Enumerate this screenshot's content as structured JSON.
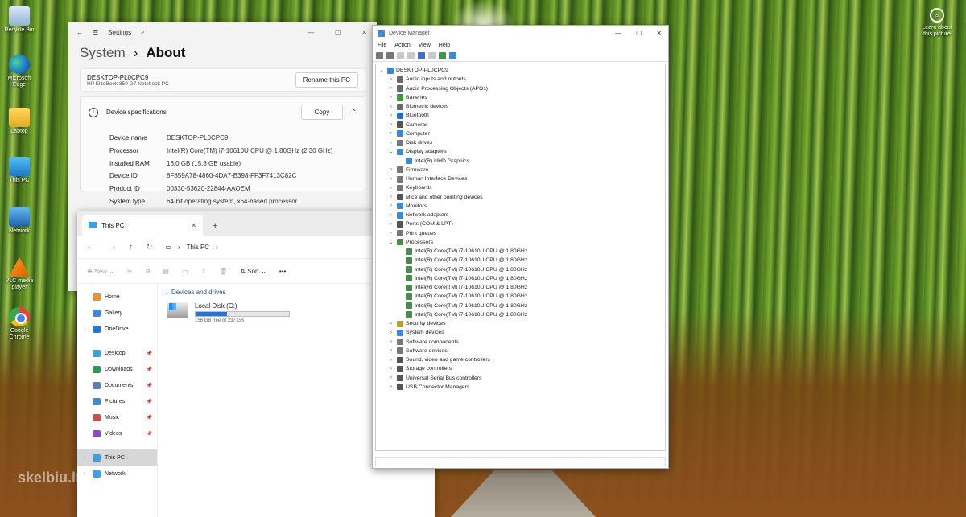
{
  "desktop": {
    "icons": [
      {
        "label": "Recycle Bin",
        "icon": "recycle-bin-icon"
      },
      {
        "label": "Microsoft Edge",
        "icon": "edge-icon"
      },
      {
        "label": "Laptop",
        "icon": "folder-icon"
      },
      {
        "label": "This PC",
        "icon": "this-pc-icon"
      },
      {
        "label": "Network",
        "icon": "network-icon"
      },
      {
        "label": "VLC media player",
        "icon": "vlc-icon"
      },
      {
        "label": "Google Chrome",
        "icon": "chrome-icon"
      }
    ],
    "learn_label": "Learn about this picture",
    "watermark": "skelbiu.lt"
  },
  "settings": {
    "app_title": "Settings",
    "breadcrumb_parent": "System",
    "breadcrumb_sep": "›",
    "page_title": "About",
    "device_title": "DESKTOP-PL0CPC9",
    "device_model": "HP EliteBook 850 G7 Notebook PC",
    "rename_label": "Rename this PC",
    "specs_header": "Device specifications",
    "copy_label": "Copy",
    "specs": [
      {
        "key": "Device name",
        "value": "DESKTOP-PL0CPC9"
      },
      {
        "key": "Processor",
        "value": "Intel(R) Core(TM) i7-10610U CPU @ 1.80GHz (2.30 GHz)"
      },
      {
        "key": "Installed RAM",
        "value": "16.0 GB (15.8 GB usable)"
      },
      {
        "key": "Device ID",
        "value": "8F859A78-4860-4DA7-B398-FF3F7413C82C"
      },
      {
        "key": "Product ID",
        "value": "00330-53620-22844-AAOEM"
      },
      {
        "key": "System type",
        "value": "64-bit operating system, x64-based processor"
      }
    ]
  },
  "explorer": {
    "tab_title": "This PC",
    "address": "This PC",
    "new_label": "New",
    "sort_label": "Sort",
    "section_title": "Devices and drives",
    "drive_name": "Local Disk (C:)",
    "drive_used_fraction": 0.34,
    "drive_free": "156 GB free of 237 GB",
    "sidebar": [
      {
        "label": "Home",
        "color": "#e9903a",
        "pin": false
      },
      {
        "label": "Gallery",
        "color": "#3d8bd8",
        "pin": false
      },
      {
        "label": "OneDrive",
        "color": "#1f7ad8",
        "pin": false
      },
      {
        "label": "Desktop",
        "color": "#3aa0e8",
        "pin": true
      },
      {
        "label": "Downloads",
        "color": "#2d9a52",
        "pin": true
      },
      {
        "label": "Documents",
        "color": "#5a7fb8",
        "pin": true
      },
      {
        "label": "Pictures",
        "color": "#3d8bd8",
        "pin": true
      },
      {
        "label": "Music",
        "color": "#d24a4a",
        "pin": true
      },
      {
        "label": "Videos",
        "color": "#8a4ad2",
        "pin": true
      },
      {
        "label": "This PC",
        "color": "#3aa0e8",
        "pin": false
      },
      {
        "label": "Network",
        "color": "#3aa0e8",
        "pin": false
      }
    ]
  },
  "devmgr": {
    "title": "Device Manager",
    "menu": [
      "File",
      "Action",
      "View",
      "Help"
    ],
    "root": "DESKTOP-PL0CPC9",
    "tree": [
      {
        "label": "Audio inputs and outputs",
        "level": 1,
        "expanded": false,
        "color": "#6a6a6a"
      },
      {
        "label": "Audio Processing Objects (APOs)",
        "level": 1,
        "expanded": false,
        "color": "#6a6a6a"
      },
      {
        "label": "Batteries",
        "level": 1,
        "expanded": false,
        "color": "#3a9b3a"
      },
      {
        "label": "Biometric devices",
        "level": 1,
        "expanded": false,
        "color": "#6a6a6a"
      },
      {
        "label": "Bluetooth",
        "level": 1,
        "expanded": false,
        "color": "#1f6fd8"
      },
      {
        "label": "Cameras",
        "level": 1,
        "expanded": false,
        "color": "#555555"
      },
      {
        "label": "Computer",
        "level": 1,
        "expanded": false,
        "color": "#3a8ad8"
      },
      {
        "label": "Disk drives",
        "level": 1,
        "expanded": false,
        "color": "#777777"
      },
      {
        "label": "Display adapters",
        "level": 1,
        "expanded": true,
        "color": "#3a8ad8"
      },
      {
        "label": "Intel(R) UHD Graphics",
        "level": 2,
        "expanded": null,
        "color": "#3a8ad8"
      },
      {
        "label": "Firmware",
        "level": 1,
        "expanded": false,
        "color": "#777777"
      },
      {
        "label": "Human Interface Devices",
        "level": 1,
        "expanded": false,
        "color": "#777777"
      },
      {
        "label": "Keyboards",
        "level": 1,
        "expanded": false,
        "color": "#777777"
      },
      {
        "label": "Mice and other pointing devices",
        "level": 1,
        "expanded": false,
        "color": "#555555"
      },
      {
        "label": "Monitors",
        "level": 1,
        "expanded": false,
        "color": "#3a8ad8"
      },
      {
        "label": "Network adapters",
        "level": 1,
        "expanded": false,
        "color": "#3a8ad8"
      },
      {
        "label": "Ports (COM & LPT)",
        "level": 1,
        "expanded": false,
        "color": "#555555"
      },
      {
        "label": "Print queues",
        "level": 1,
        "expanded": false,
        "color": "#777777"
      },
      {
        "label": "Processors",
        "level": 1,
        "expanded": true,
        "color": "#4a8a4a"
      },
      {
        "label": "Intel(R) Core(TM) i7-10610U CPU @ 1.80GHz",
        "level": 2,
        "expanded": null,
        "color": "#4a8a4a"
      },
      {
        "label": "Intel(R) Core(TM) i7-10610U CPU @ 1.80GHz",
        "level": 2,
        "expanded": null,
        "color": "#4a8a4a"
      },
      {
        "label": "Intel(R) Core(TM) i7-10610U CPU @ 1.80GHz",
        "level": 2,
        "expanded": null,
        "color": "#4a8a4a"
      },
      {
        "label": "Intel(R) Core(TM) i7-10610U CPU @ 1.80GHz",
        "level": 2,
        "expanded": null,
        "color": "#4a8a4a"
      },
      {
        "label": "Intel(R) Core(TM) i7-10610U CPU @ 1.80GHz",
        "level": 2,
        "expanded": null,
        "color": "#4a8a4a"
      },
      {
        "label": "Intel(R) Core(TM) i7-10610U CPU @ 1.80GHz",
        "level": 2,
        "expanded": null,
        "color": "#4a8a4a"
      },
      {
        "label": "Intel(R) Core(TM) i7-10610U CPU @ 1.80GHz",
        "level": 2,
        "expanded": null,
        "color": "#4a8a4a"
      },
      {
        "label": "Intel(R) Core(TM) i7-10610U CPU @ 1.80GHz",
        "level": 2,
        "expanded": null,
        "color": "#4a8a4a"
      },
      {
        "label": "Security devices",
        "level": 1,
        "expanded": false,
        "color": "#b8a030"
      },
      {
        "label": "System devices",
        "level": 1,
        "expanded": false,
        "color": "#3a8ad8"
      },
      {
        "label": "Software components",
        "level": 1,
        "expanded": false,
        "color": "#777777"
      },
      {
        "label": "Software devices",
        "level": 1,
        "expanded": false,
        "color": "#777777"
      },
      {
        "label": "Sound, video and game controllers",
        "level": 1,
        "expanded": false,
        "color": "#555555"
      },
      {
        "label": "Storage controllers",
        "level": 1,
        "expanded": false,
        "color": "#555555"
      },
      {
        "label": "Universal Serial Bus controllers",
        "level": 1,
        "expanded": false,
        "color": "#555555"
      },
      {
        "label": "USB Connector Managers",
        "level": 1,
        "expanded": false,
        "color": "#555555"
      }
    ]
  }
}
